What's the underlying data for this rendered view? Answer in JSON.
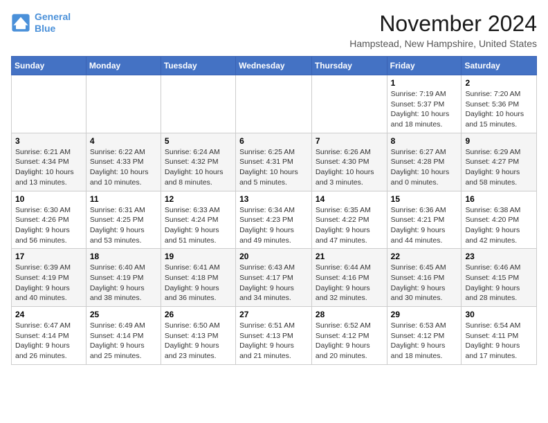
{
  "logo": {
    "line1": "General",
    "line2": "Blue"
  },
  "title": "November 2024",
  "location": "Hampstead, New Hampshire, United States",
  "weekdays": [
    "Sunday",
    "Monday",
    "Tuesday",
    "Wednesday",
    "Thursday",
    "Friday",
    "Saturday"
  ],
  "weeks": [
    [
      {
        "day": "",
        "info": ""
      },
      {
        "day": "",
        "info": ""
      },
      {
        "day": "",
        "info": ""
      },
      {
        "day": "",
        "info": ""
      },
      {
        "day": "",
        "info": ""
      },
      {
        "day": "1",
        "info": "Sunrise: 7:19 AM\nSunset: 5:37 PM\nDaylight: 10 hours and 18 minutes."
      },
      {
        "day": "2",
        "info": "Sunrise: 7:20 AM\nSunset: 5:36 PM\nDaylight: 10 hours and 15 minutes."
      }
    ],
    [
      {
        "day": "3",
        "info": "Sunrise: 6:21 AM\nSunset: 4:34 PM\nDaylight: 10 hours and 13 minutes."
      },
      {
        "day": "4",
        "info": "Sunrise: 6:22 AM\nSunset: 4:33 PM\nDaylight: 10 hours and 10 minutes."
      },
      {
        "day": "5",
        "info": "Sunrise: 6:24 AM\nSunset: 4:32 PM\nDaylight: 10 hours and 8 minutes."
      },
      {
        "day": "6",
        "info": "Sunrise: 6:25 AM\nSunset: 4:31 PM\nDaylight: 10 hours and 5 minutes."
      },
      {
        "day": "7",
        "info": "Sunrise: 6:26 AM\nSunset: 4:30 PM\nDaylight: 10 hours and 3 minutes."
      },
      {
        "day": "8",
        "info": "Sunrise: 6:27 AM\nSunset: 4:28 PM\nDaylight: 10 hours and 0 minutes."
      },
      {
        "day": "9",
        "info": "Sunrise: 6:29 AM\nSunset: 4:27 PM\nDaylight: 9 hours and 58 minutes."
      }
    ],
    [
      {
        "day": "10",
        "info": "Sunrise: 6:30 AM\nSunset: 4:26 PM\nDaylight: 9 hours and 56 minutes."
      },
      {
        "day": "11",
        "info": "Sunrise: 6:31 AM\nSunset: 4:25 PM\nDaylight: 9 hours and 53 minutes."
      },
      {
        "day": "12",
        "info": "Sunrise: 6:33 AM\nSunset: 4:24 PM\nDaylight: 9 hours and 51 minutes."
      },
      {
        "day": "13",
        "info": "Sunrise: 6:34 AM\nSunset: 4:23 PM\nDaylight: 9 hours and 49 minutes."
      },
      {
        "day": "14",
        "info": "Sunrise: 6:35 AM\nSunset: 4:22 PM\nDaylight: 9 hours and 47 minutes."
      },
      {
        "day": "15",
        "info": "Sunrise: 6:36 AM\nSunset: 4:21 PM\nDaylight: 9 hours and 44 minutes."
      },
      {
        "day": "16",
        "info": "Sunrise: 6:38 AM\nSunset: 4:20 PM\nDaylight: 9 hours and 42 minutes."
      }
    ],
    [
      {
        "day": "17",
        "info": "Sunrise: 6:39 AM\nSunset: 4:19 PM\nDaylight: 9 hours and 40 minutes."
      },
      {
        "day": "18",
        "info": "Sunrise: 6:40 AM\nSunset: 4:19 PM\nDaylight: 9 hours and 38 minutes."
      },
      {
        "day": "19",
        "info": "Sunrise: 6:41 AM\nSunset: 4:18 PM\nDaylight: 9 hours and 36 minutes."
      },
      {
        "day": "20",
        "info": "Sunrise: 6:43 AM\nSunset: 4:17 PM\nDaylight: 9 hours and 34 minutes."
      },
      {
        "day": "21",
        "info": "Sunrise: 6:44 AM\nSunset: 4:16 PM\nDaylight: 9 hours and 32 minutes."
      },
      {
        "day": "22",
        "info": "Sunrise: 6:45 AM\nSunset: 4:16 PM\nDaylight: 9 hours and 30 minutes."
      },
      {
        "day": "23",
        "info": "Sunrise: 6:46 AM\nSunset: 4:15 PM\nDaylight: 9 hours and 28 minutes."
      }
    ],
    [
      {
        "day": "24",
        "info": "Sunrise: 6:47 AM\nSunset: 4:14 PM\nDaylight: 9 hours and 26 minutes."
      },
      {
        "day": "25",
        "info": "Sunrise: 6:49 AM\nSunset: 4:14 PM\nDaylight: 9 hours and 25 minutes."
      },
      {
        "day": "26",
        "info": "Sunrise: 6:50 AM\nSunset: 4:13 PM\nDaylight: 9 hours and 23 minutes."
      },
      {
        "day": "27",
        "info": "Sunrise: 6:51 AM\nSunset: 4:13 PM\nDaylight: 9 hours and 21 minutes."
      },
      {
        "day": "28",
        "info": "Sunrise: 6:52 AM\nSunset: 4:12 PM\nDaylight: 9 hours and 20 minutes."
      },
      {
        "day": "29",
        "info": "Sunrise: 6:53 AM\nSunset: 4:12 PM\nDaylight: 9 hours and 18 minutes."
      },
      {
        "day": "30",
        "info": "Sunrise: 6:54 AM\nSunset: 4:11 PM\nDaylight: 9 hours and 17 minutes."
      }
    ]
  ]
}
